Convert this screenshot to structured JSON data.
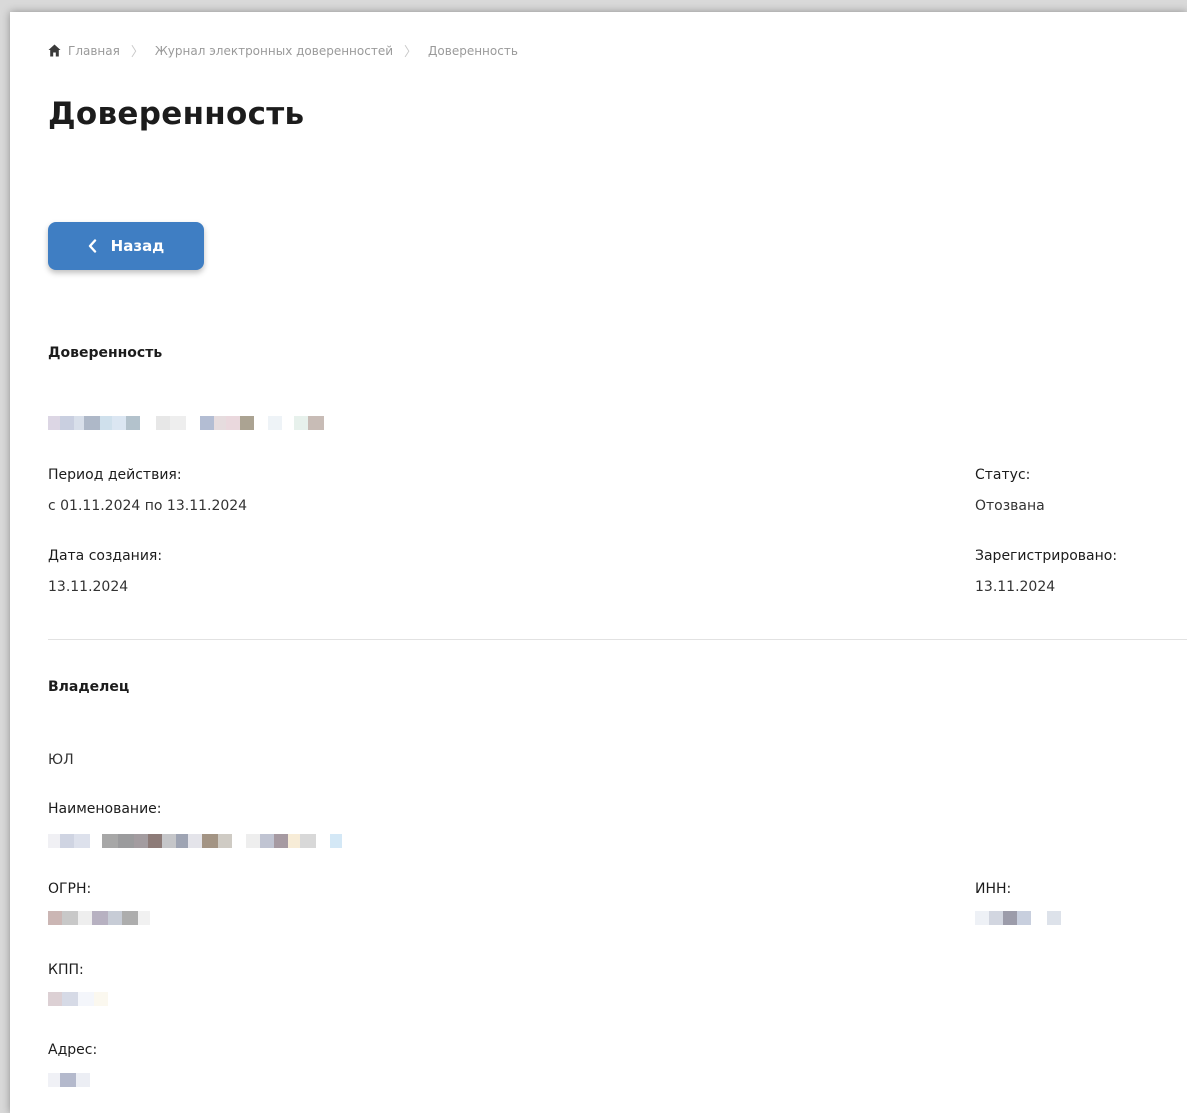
{
  "breadcrumb": {
    "home": "Главная",
    "journal": "Журнал электронных доверенностей",
    "current": "Доверенность"
  },
  "page_title": "Доверенность",
  "back_button": {
    "label": "Назад"
  },
  "poa_section": {
    "heading": "Доверенность",
    "period_label": "Период действия:",
    "period_value": "с 01.11.2024 по 13.11.2024",
    "status_label": "Статус:",
    "status_value": "Отозвана",
    "created_label": "Дата создания:",
    "created_value": "13.11.2024",
    "registered_label": "Зарегистрировано:",
    "registered_value": "13.11.2024"
  },
  "owner_section": {
    "heading": "Владелец",
    "type": "ЮЛ",
    "name_label": "Наименование:",
    "ogrn_label": "ОГРН:",
    "inn_label": "ИНН:",
    "kpp_label": "КПП:",
    "address_label": "Адрес:"
  },
  "colors": {
    "accent": "#3f7ec3",
    "text": "#1c1c1c",
    "muted": "#9a9a9a",
    "divider": "#e2e2e2"
  },
  "icons": {
    "home": "home-icon",
    "separator": "chevron-right-icon",
    "back": "chevron-left-icon"
  }
}
